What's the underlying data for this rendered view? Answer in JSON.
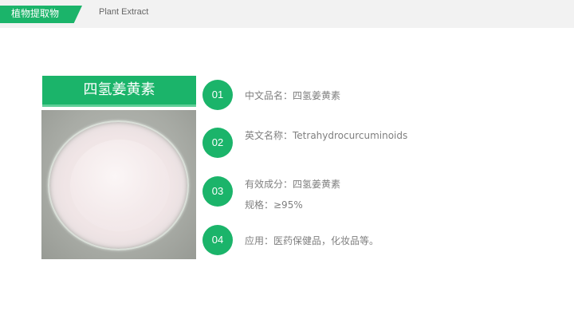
{
  "header": {
    "tag": "植物提取物",
    "subtitle": "Plant Extract"
  },
  "product": {
    "title": "四氢姜黄素",
    "image": "white-powder-in-petri-dish"
  },
  "items": [
    {
      "number": "01",
      "lines": [
        "中文品名：四氢姜黄素"
      ]
    },
    {
      "number": "02",
      "lines": [
        "英文名称：Tetrahydrocurcuminoids"
      ]
    },
    {
      "number": "03",
      "lines": [
        "有效成分：四氢姜黄素",
        "规格：≥95%"
      ]
    },
    {
      "number": "04",
      "lines": [
        "应用：医药保健品，化妆品等。"
      ]
    }
  ],
  "colors": {
    "accent": "#1bb46a",
    "text": "#7f7f7f",
    "topbar": "#f2f2f2"
  }
}
